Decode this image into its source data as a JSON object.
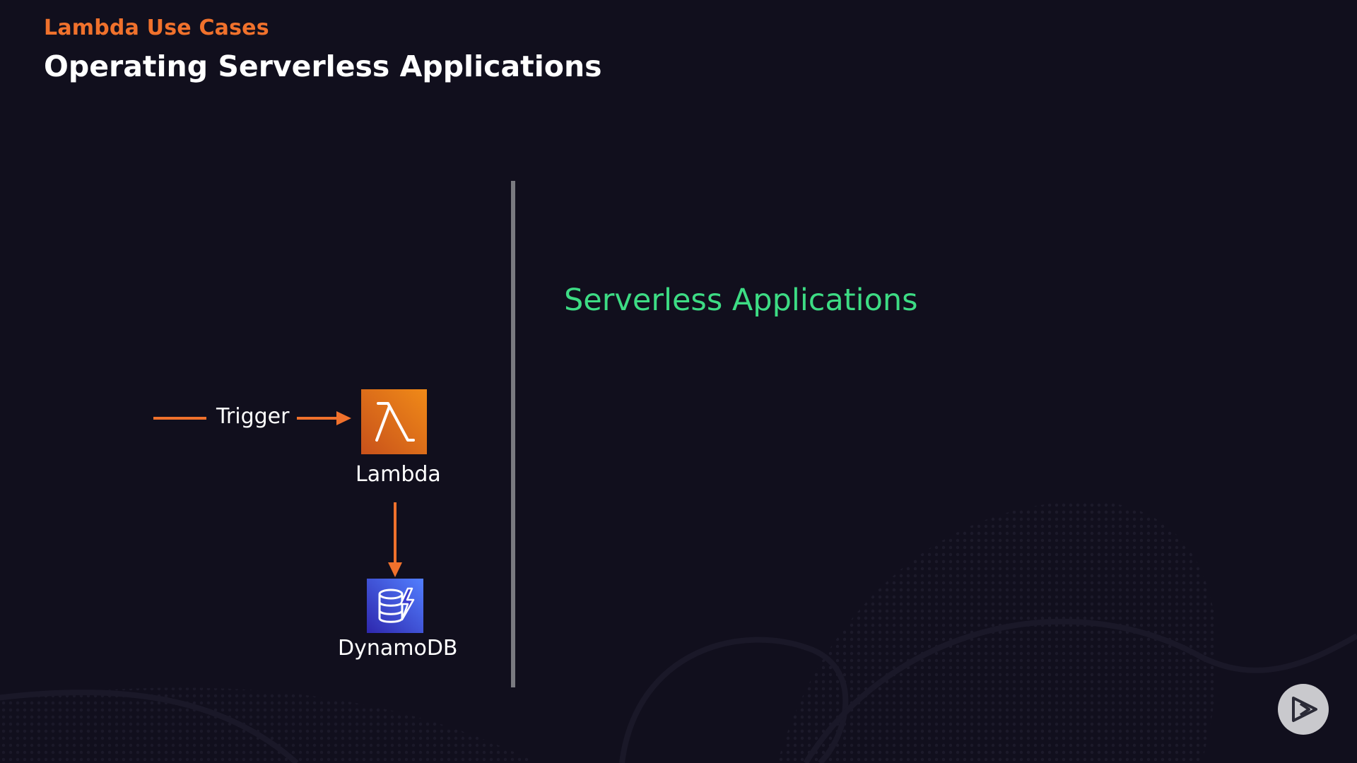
{
  "header": {
    "kicker": "Lambda Use Cases",
    "title": "Operating Serverless Applications"
  },
  "diagram": {
    "trigger_label": "Trigger",
    "lambda_label": "Lambda",
    "dynamodb_label": "DynamoDB",
    "lambda_icon": "lambda-icon",
    "dynamodb_icon": "dynamodb-icon"
  },
  "section": {
    "heading": "Serverless Applications"
  },
  "player": {
    "icon": "play-icon"
  },
  "colors": {
    "background": "#110f1d",
    "accent_orange": "#f0712c",
    "heading_green": "#3ddc84",
    "divider_gray": "#7a7a80"
  }
}
